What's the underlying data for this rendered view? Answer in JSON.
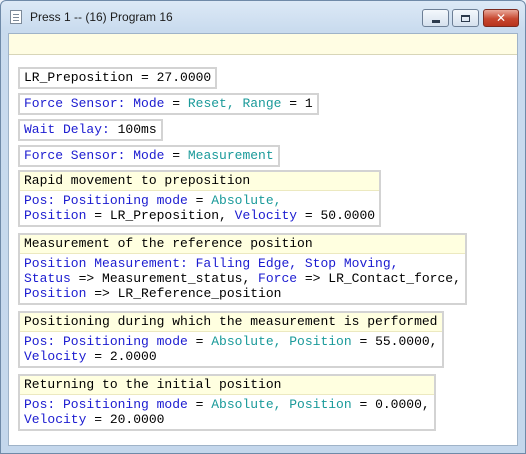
{
  "window": {
    "title": "Press 1 -- (16) Program 16",
    "minimize_label": "—",
    "maximize_label": "□",
    "close_label": "✕"
  },
  "program": {
    "line1": {
      "text": "LR_Preposition = 27.0000"
    },
    "line2": {
      "keyword": "Force Sensor: Mode",
      "op": " = ",
      "value": "Reset, Range",
      "op2": " = ",
      "value2": "1"
    },
    "line3": {
      "keyword": "Wait Delay:",
      "value": " 100ms"
    },
    "line4": {
      "keyword": "Force Sensor: Mode",
      "op": " = ",
      "value": "Measurement"
    },
    "group1": {
      "header": "Rapid movement to preposition",
      "l1_kw": "Pos: Positioning mode",
      "l1_op": " = ",
      "l1_val": "Absolute,",
      "l2_kw": "Position",
      "l2_op": " = LR_Preposition, ",
      "l2_kw2": "Velocity",
      "l2_rest": " = 50.0000"
    },
    "group2": {
      "header": "Measurement of the reference position",
      "l1": "Position Measurement: Falling Edge, Stop Moving,",
      "l2_kw": "Status",
      "l2_mid": " => Measurement_status, ",
      "l2_kw2": "Force",
      "l2_rest": " => LR_Contact_force,",
      "l3_kw": "Position",
      "l3_rest": " => LR_Reference_position"
    },
    "group3": {
      "header": "Positioning during which the measurement is performed",
      "l1_kw": "Pos: Positioning mode",
      "l1_op": " = ",
      "l1_val": "Absolute, Position",
      "l1_rest": " = 55.0000,",
      "l2_kw": "Velocity",
      "l2_rest": " = 2.0000"
    },
    "group4": {
      "header": "Returning to the initial position",
      "l1_kw": "Pos: Positioning mode",
      "l1_op": " = ",
      "l1_val": "Absolute, Position",
      "l1_rest": " = 0.0000,",
      "l2_kw": "Velocity",
      "l2_rest": " = 20.0000"
    }
  },
  "colors": {
    "keyword": "#1b1bd0",
    "value": "#1a9a9a",
    "header_bg": "#ffffe0",
    "block_border": "#d3d3d3"
  },
  "icons": [
    "document-icon",
    "minimize-icon",
    "maximize-icon",
    "close-icon"
  ]
}
